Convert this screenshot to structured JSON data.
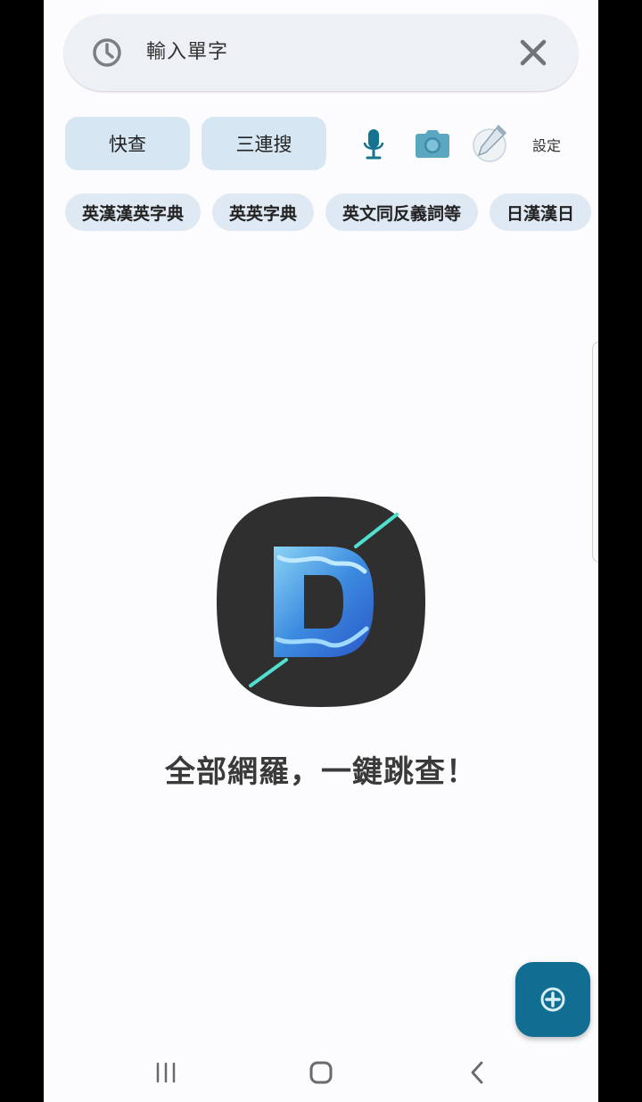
{
  "search": {
    "text": "輸入單字"
  },
  "buttons": {
    "quick": "快查",
    "triple": "三連搜"
  },
  "toolbar": {
    "settings_label": "設定"
  },
  "chips": [
    "英漢漢英字典",
    "英英字典",
    "英文同反義詞等",
    "日漢漢日"
  ],
  "slogan": "全部網羅，一鍵跳查！",
  "icons": {
    "history": "history-icon",
    "clear": "close-icon",
    "mic": "microphone-icon",
    "camera": "camera-icon",
    "pen": "pen-icon",
    "logo": "dictionary-d-logo",
    "fab": "plus-circle-icon",
    "recent": "recent-apps-icon",
    "home": "home-icon",
    "back": "back-icon"
  },
  "colors": {
    "accent": "#116e92",
    "chip_bg": "#dfe9f3",
    "button_bg": "#d6e6f3",
    "search_bg": "#edf0f4"
  }
}
